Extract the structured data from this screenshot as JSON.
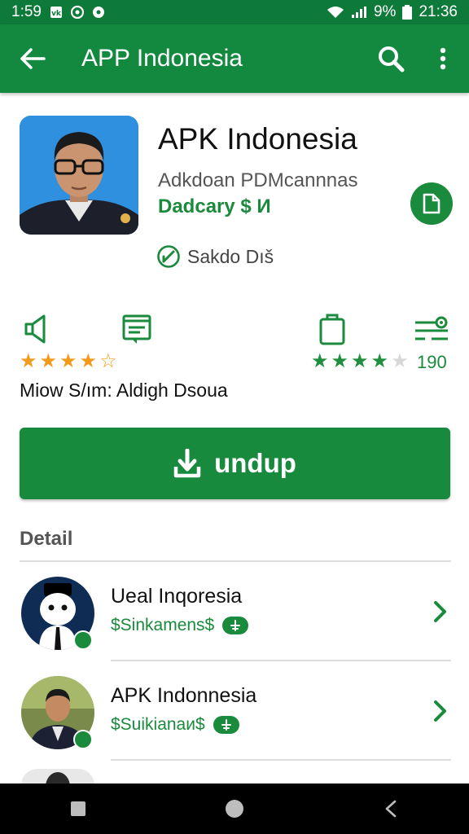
{
  "status_bar": {
    "time": "1:59",
    "battery_percent": "9%",
    "clock_right": "21:36",
    "notification_icons": [
      "vk-icon",
      "notification-icon",
      "dot-icon"
    ],
    "system_icons": [
      "wifi-icon",
      "signal-icon",
      "battery-icon"
    ]
  },
  "app_bar": {
    "title": "APP Indonesia",
    "background": "#12893f",
    "actions": [
      "search-icon",
      "more-vert-icon"
    ]
  },
  "app": {
    "title": "APK Indonesia",
    "subtitle": "Adkdoan PDMcannnas",
    "developer": "Dadcary $ И",
    "safety_text": "Sakdo Dıš",
    "accent": "#1a8a3c"
  },
  "stats": {
    "left_icons": [
      "speaker-icon",
      "message-box-icon"
    ],
    "right_icons": [
      "clipboard-icon",
      "settings-slider-icon"
    ],
    "left_rating": 4,
    "left_rating_max": 5,
    "right_rating": 4,
    "right_rating_max": 5,
    "rating_count": "190",
    "caption": "Miow S/ım: Aldigh Dsoua"
  },
  "install": {
    "label": "undup",
    "icon": "download-icon"
  },
  "section": {
    "title": "Detail"
  },
  "related": [
    {
      "title": "Ueal Inqoresia",
      "subtitle": "$Sinkamens$",
      "avatar": "cartoon-avatar"
    },
    {
      "title": "APK Indonnesia",
      "subtitle": "$Suikianaи$",
      "avatar": "person-avatar"
    }
  ],
  "nav_bar": {
    "buttons": [
      "recents-square-icon",
      "home-circle-icon",
      "back-triangle-icon"
    ]
  }
}
